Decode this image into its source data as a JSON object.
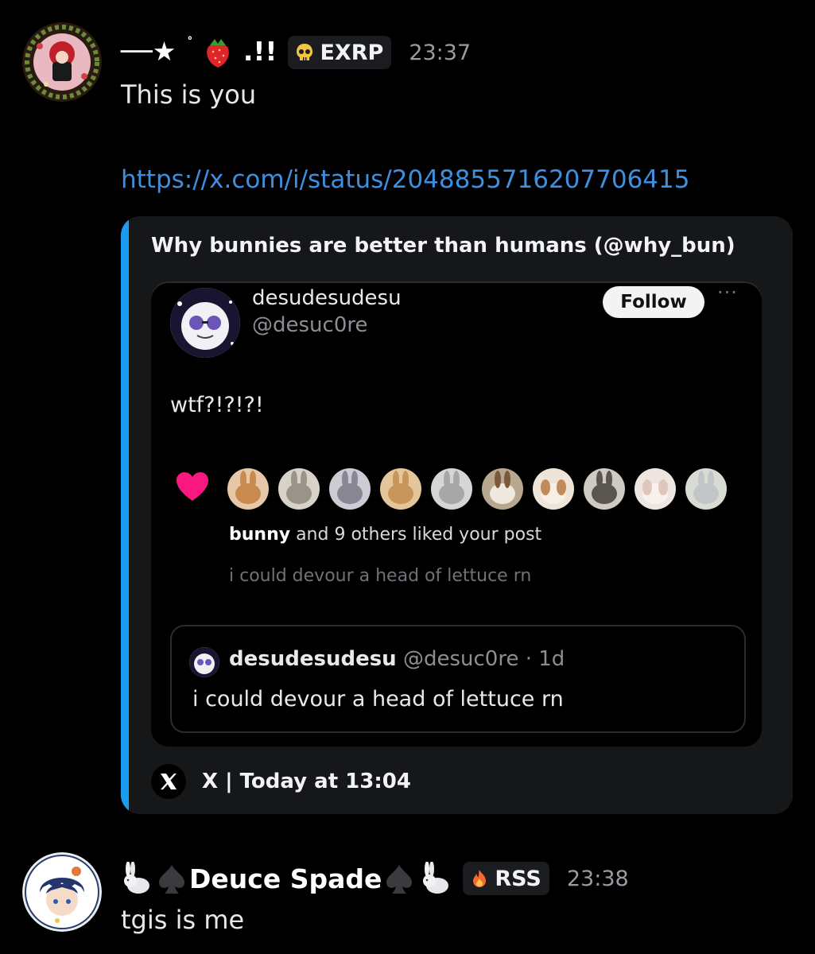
{
  "messages": [
    {
      "display_name_prefix": "──★",
      "display_name_suffix": ".!!",
      "tag": "EXRP",
      "tag_icon": "skull-icon",
      "time": "23:37",
      "text": "This is you",
      "link": "https://x.com/i/status/2048855716207706415"
    },
    {
      "display_name": "Deuce Spade",
      "tag": "RSS",
      "tag_icon": "fire-icon",
      "time": "23:38",
      "text": "tgis is me"
    }
  ],
  "embed": {
    "accent_color": "#1d9bf0",
    "title": "Why bunnies are better than humans (@why_bun)",
    "footer": "X | Today at 13:04",
    "screenshot": {
      "author_name": "desudesudesu",
      "author_handle": "@desuc0re",
      "follow_label": "Follow",
      "more_label": "···",
      "post_text": "wtf?!?!?!",
      "likes_user": "bunny",
      "likes_rest": " and 9 others liked your post",
      "preview_text": "i could devour a head of lettuce rn",
      "quote": {
        "name": "desudesudesu",
        "handle_time": " @desuc0re · 1d",
        "text": "i could devour a head of lettuce rn"
      },
      "liker_avatars": [
        "bunny-1",
        "bunny-2",
        "bunny-3",
        "bunny-4",
        "bunny-5",
        "bunny-6",
        "bunny-7",
        "bunny-8",
        "bunny-9",
        "bunny-10"
      ]
    }
  }
}
